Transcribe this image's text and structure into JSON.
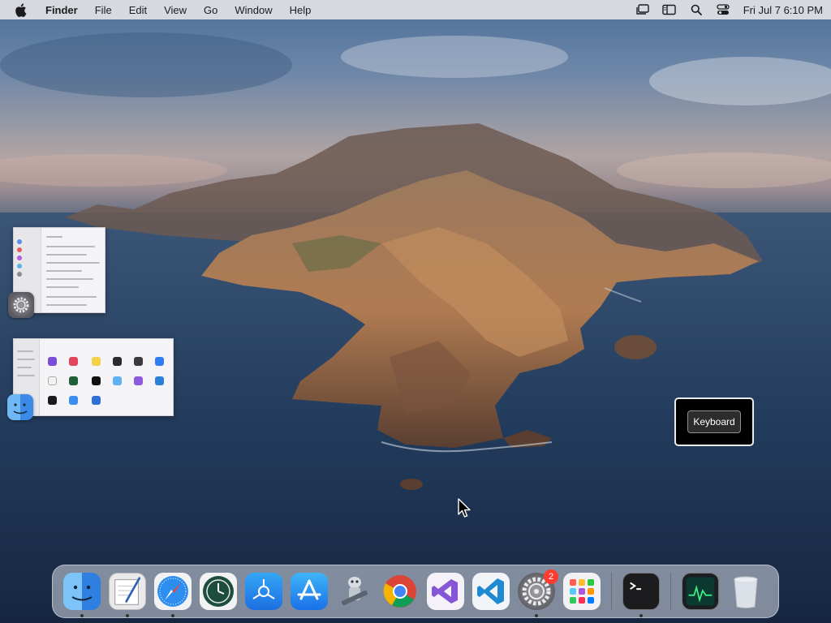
{
  "menubar": {
    "app_name": "Finder",
    "menus": [
      "File",
      "Edit",
      "View",
      "Go",
      "Window",
      "Help"
    ],
    "icons": [
      "stage-manager-icon",
      "sidebar-icon",
      "search-icon",
      "control-center-icon"
    ],
    "clock": "Fri Jul 7  6:10 PM"
  },
  "desktop": {
    "tooltip_label": "Keyboard"
  },
  "thumbnails": [
    {
      "app": "System Settings",
      "icon": "gear-icon"
    },
    {
      "app": "Finder",
      "icon": "finder-icon"
    }
  ],
  "dock": {
    "items": [
      {
        "name": "finder",
        "icon": "finder-icon",
        "running": true
      },
      {
        "name": "textedit",
        "icon": "textedit-icon",
        "running": true
      },
      {
        "name": "safari",
        "icon": "safari-icon",
        "running": true
      },
      {
        "name": "time-machine",
        "icon": "time-machine-icon",
        "running": false
      },
      {
        "name": "testflight",
        "icon": "testflight-icon",
        "running": false
      },
      {
        "name": "app-store",
        "icon": "app-store-icon",
        "running": false
      },
      {
        "name": "automator",
        "icon": "automator-icon",
        "running": false
      },
      {
        "name": "chrome",
        "icon": "chrome-icon",
        "running": false
      },
      {
        "name": "visual-studio",
        "icon": "visual-studio-icon",
        "running": false
      },
      {
        "name": "vscode",
        "icon": "vscode-icon",
        "running": false
      },
      {
        "name": "system-settings",
        "icon": "gear-icon",
        "running": true,
        "badge": "2"
      },
      {
        "name": "launchpad",
        "icon": "launchpad-icon",
        "running": false
      },
      {
        "name": "terminal",
        "icon": "terminal-icon",
        "running": true
      },
      {
        "name": "activity-monitor",
        "icon": "activity-monitor-icon",
        "running": false
      },
      {
        "name": "trash",
        "icon": "trash-icon",
        "running": false
      }
    ],
    "settings_badge": "2"
  },
  "colors": {
    "menubar": "#e2e2e6",
    "badge": "#ff3b30",
    "sea": "#1c3150"
  }
}
